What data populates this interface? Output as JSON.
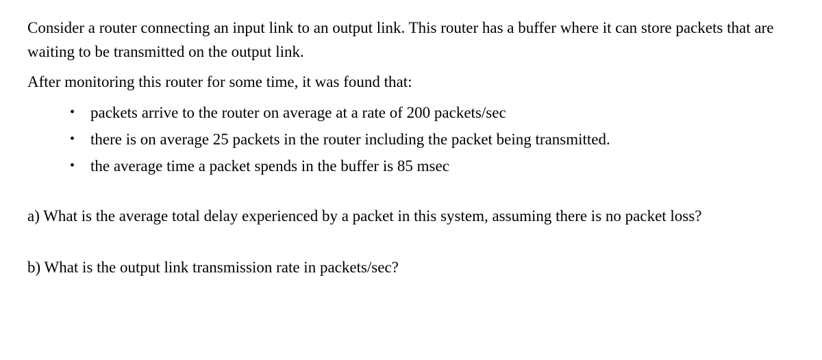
{
  "intro": {
    "p1": "Consider a router connecting an input link to an output link. This router has a buffer where it can store packets that are waiting to be transmitted on the output link.",
    "p2": "After monitoring this router for some time, it was found that:"
  },
  "bullets": [
    "packets arrive to the router on average at a rate of 200 packets/sec",
    "there is on average 25 packets in the router including the packet being transmitted.",
    "the average time a packet spends in the buffer is 85 msec"
  ],
  "questions": {
    "a": "a) What is the average total delay experienced by a packet in this system, assuming there is no packet loss?",
    "b": "b) What is the output link transmission rate in packets/sec?"
  }
}
